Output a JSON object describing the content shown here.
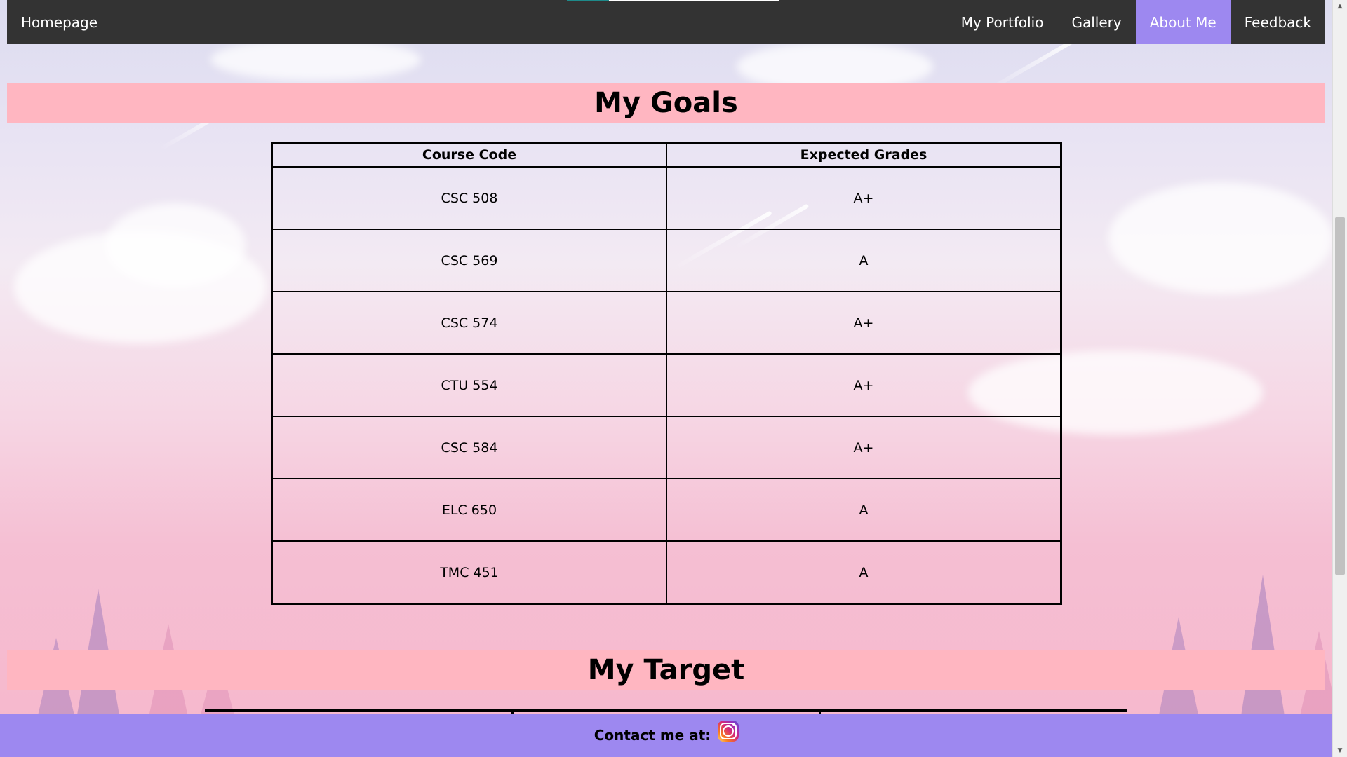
{
  "nav": {
    "home": "Homepage",
    "items": [
      {
        "label": "My Portfolio",
        "active": false
      },
      {
        "label": "Gallery",
        "active": false
      },
      {
        "label": "About Me",
        "active": true
      },
      {
        "label": "Feedback",
        "active": false
      }
    ]
  },
  "goals": {
    "title": "My Goals",
    "headers": [
      "Course Code",
      "Expected Grades"
    ],
    "rows": [
      [
        "CSC 508",
        "A+"
      ],
      [
        "CSC 569",
        "A"
      ],
      [
        "CSC 574",
        "A+"
      ],
      [
        "CTU 554",
        "A+"
      ],
      [
        "CSC 584",
        "A+"
      ],
      [
        "ELC 650",
        "A"
      ],
      [
        "TMC 451",
        "A"
      ]
    ]
  },
  "target": {
    "title": "My Target"
  },
  "footer": {
    "contact_label": "Contact me at:",
    "icon": "instagram-icon"
  },
  "colors": {
    "nav_bg": "#333333",
    "active_bg": "#9d88f0",
    "header_bg": "#ffb6c1",
    "footer_bg": "#9d88f0"
  }
}
